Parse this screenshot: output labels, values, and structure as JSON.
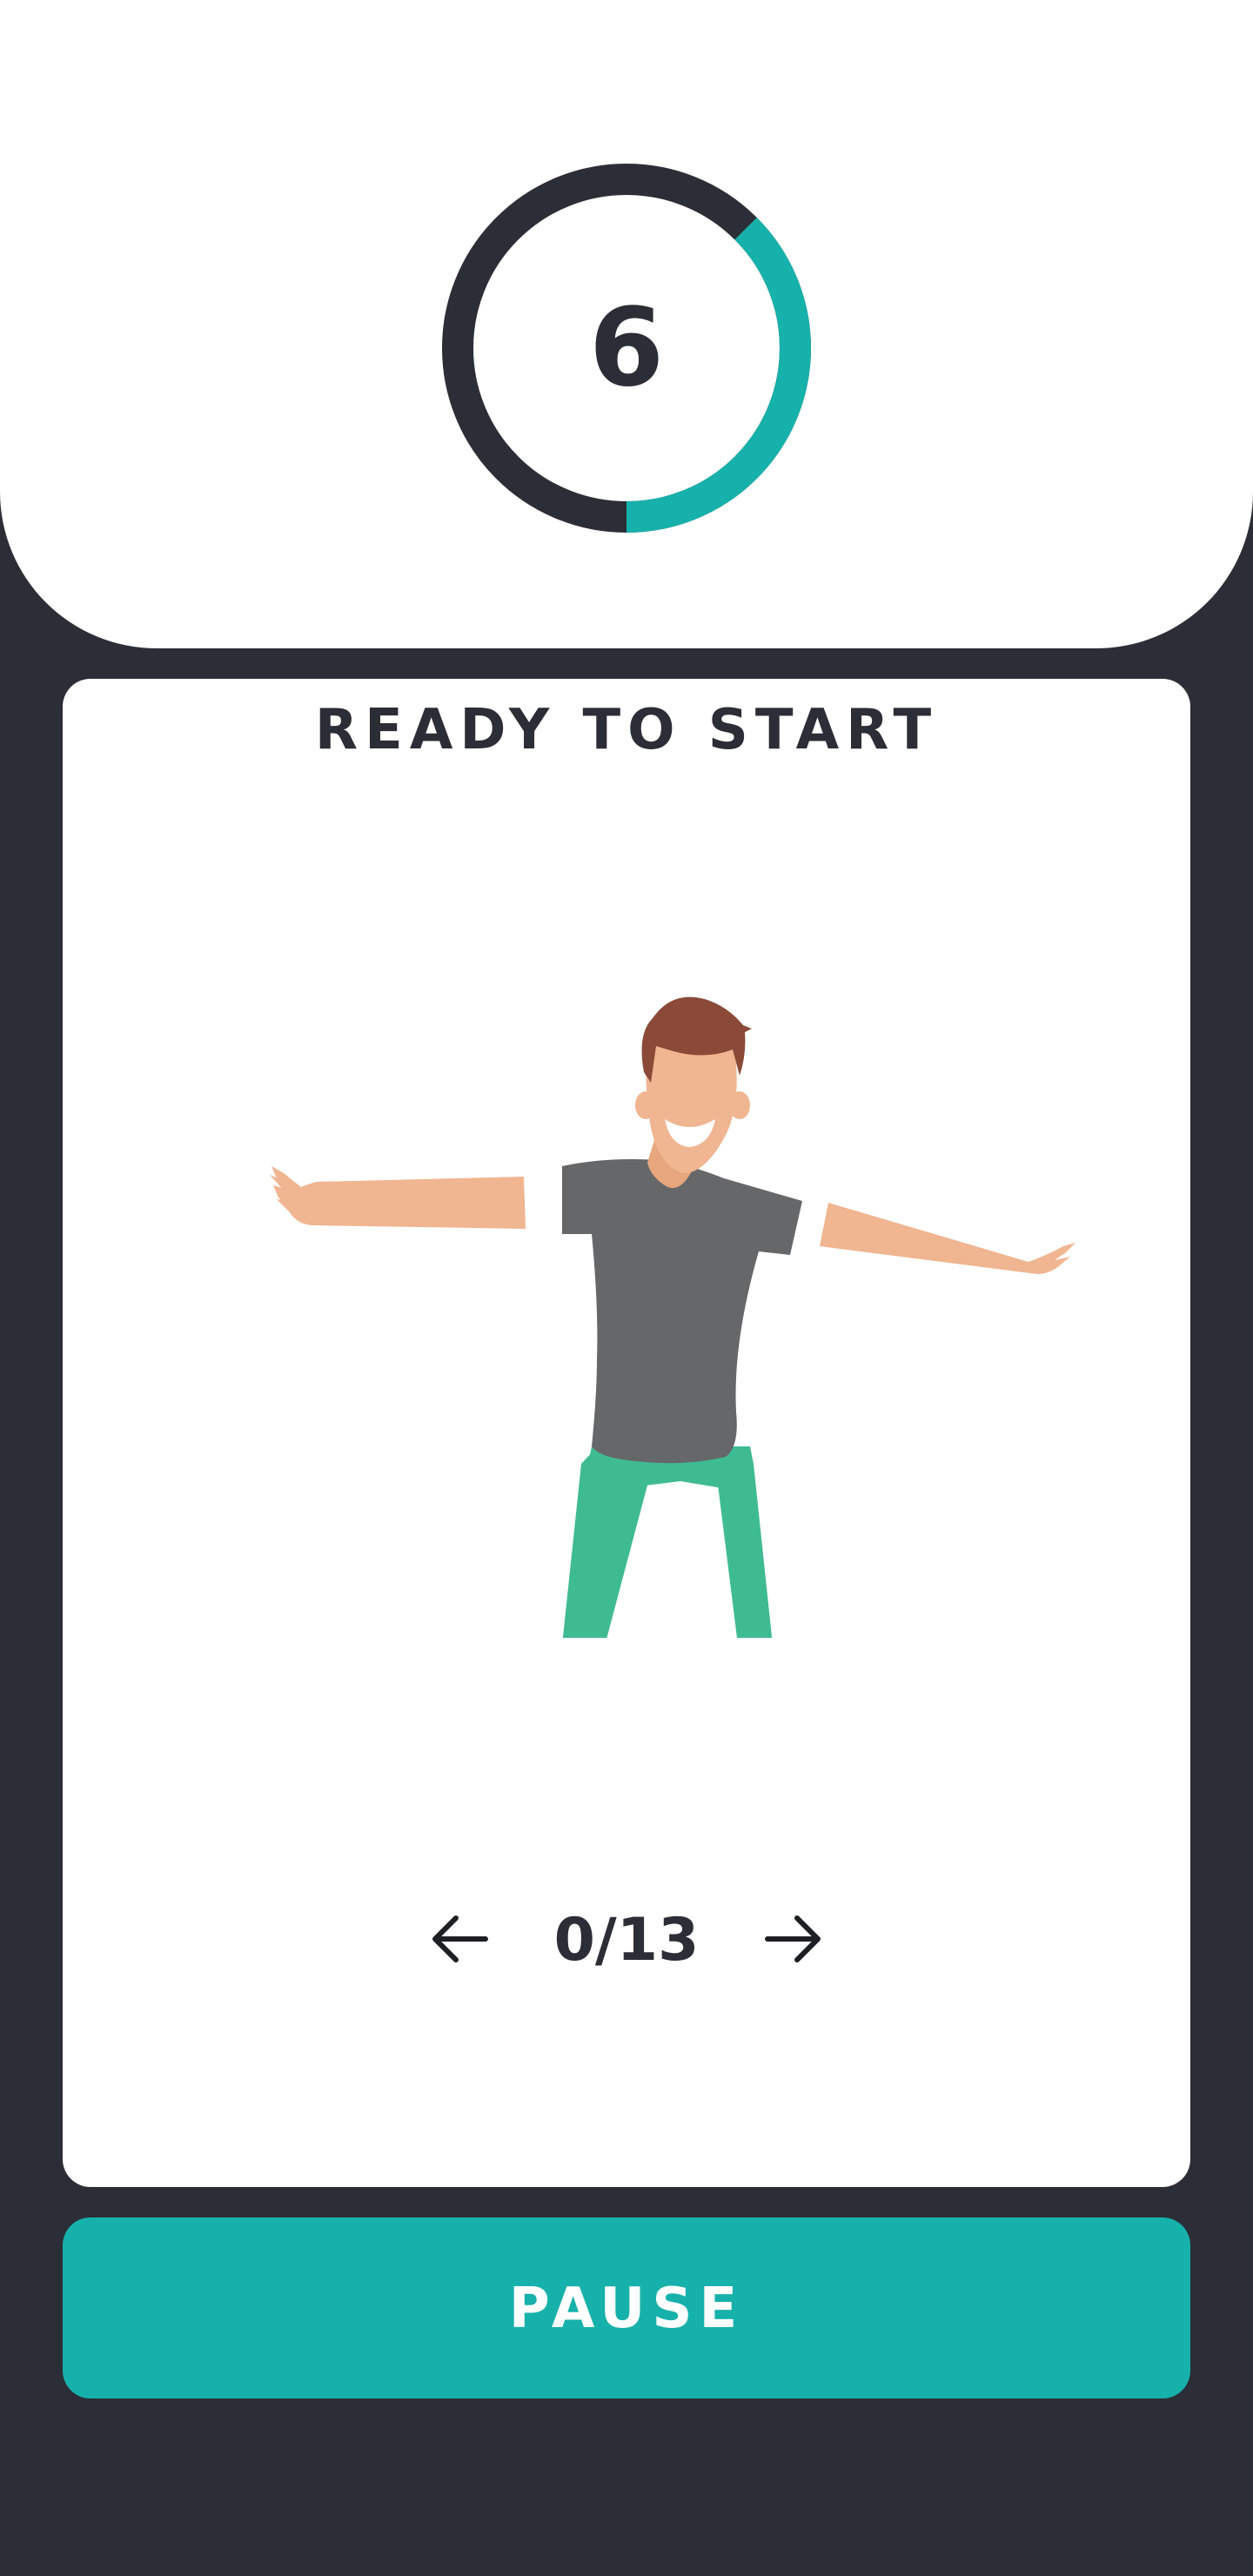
{
  "timer": {
    "value": "6",
    "progress_fraction": 0.375,
    "progress_color": "#17b1ab",
    "track_color": "#2b2e36"
  },
  "card": {
    "title": "READY TO START",
    "illustration": "person-arms-outstretched",
    "nav": {
      "prev_icon": "arrow-left-icon",
      "counter": "0/13",
      "next_icon": "arrow-right-icon"
    }
  },
  "pause_button": {
    "label": "PAUSE",
    "color": "#17b1ab"
  }
}
